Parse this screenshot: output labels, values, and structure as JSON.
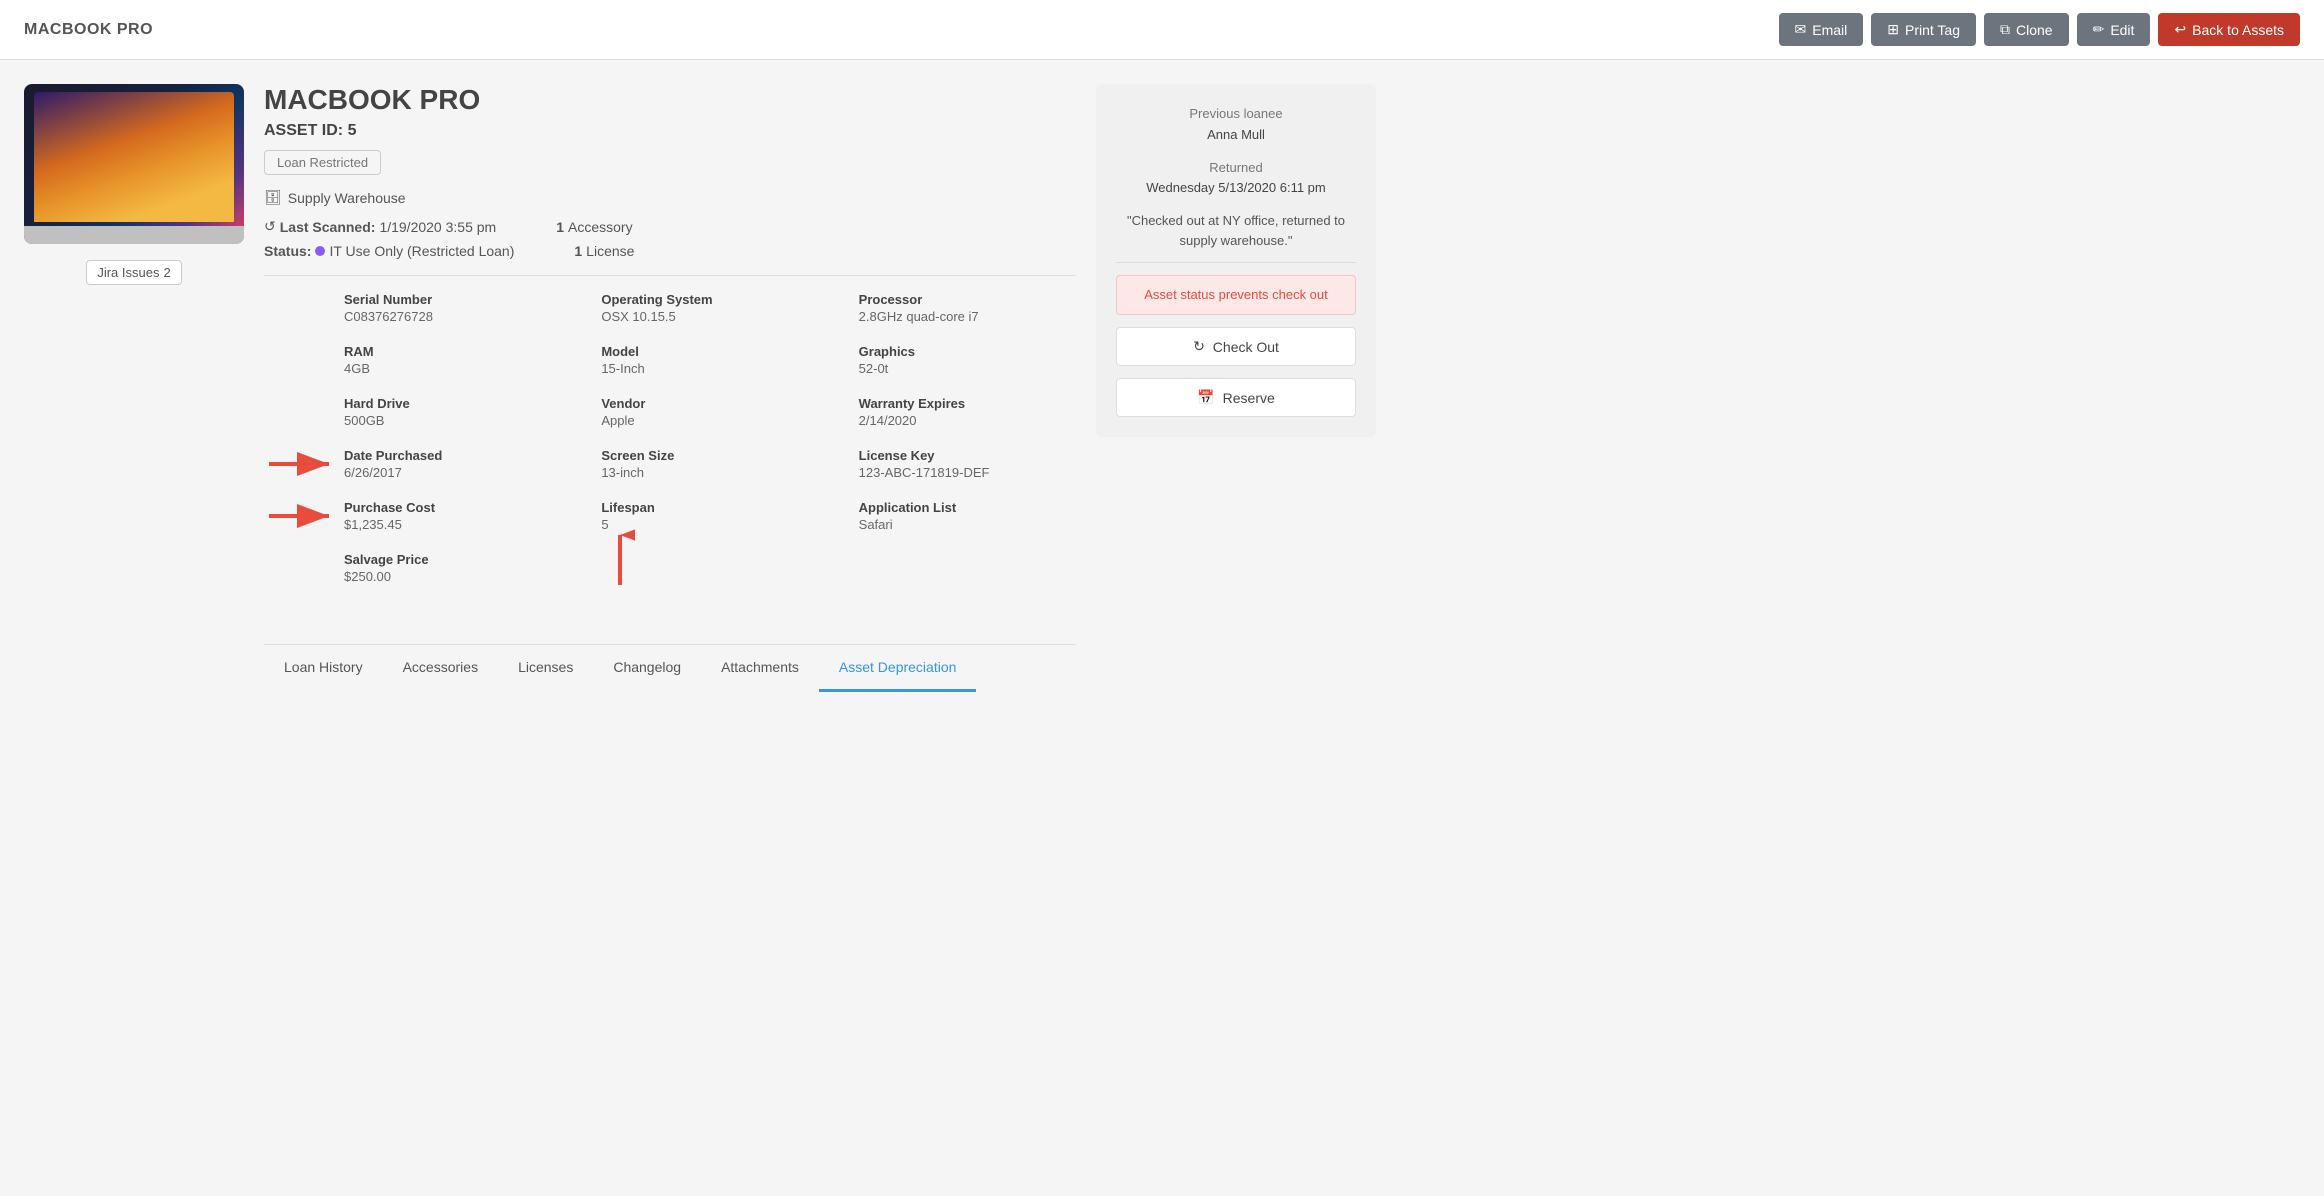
{
  "header": {
    "title": "MACBOOK PRO",
    "buttons": {
      "email": "Email",
      "print_tag": "Print Tag",
      "clone": "Clone",
      "edit": "Edit",
      "back": "Back to Assets"
    }
  },
  "asset": {
    "name": "MACBOOK PRO",
    "id_label": "ASSET ID:",
    "id_value": "5",
    "loan_status": "Loan Restricted",
    "location_icon": "🗄",
    "location": "Supply Warehouse",
    "last_scanned_label": "Last Scanned:",
    "last_scanned": "1/19/2020 3:55 pm",
    "accessory_count": "1",
    "accessory_label": "Accessory",
    "status_label": "Status:",
    "status_value": "IT Use Only (Restricted Loan)",
    "license_count": "1",
    "license_label": "License",
    "jira_label": "Jira Issues",
    "jira_count": "2"
  },
  "specs": [
    {
      "label": "Serial Number",
      "value": "C08376276728"
    },
    {
      "label": "Operating System",
      "value": "OSX 10.15.5"
    },
    {
      "label": "Processor",
      "value": "2.8GHz quad-core i7"
    },
    {
      "label": "RAM",
      "value": "4GB"
    },
    {
      "label": "Model",
      "value": "15-Inch"
    },
    {
      "label": "Graphics",
      "value": "52-0t"
    },
    {
      "label": "Hard Drive",
      "value": "500GB"
    },
    {
      "label": "Vendor",
      "value": "Apple"
    },
    {
      "label": "Warranty Expires",
      "value": "2/14/2020"
    },
    {
      "label": "Date Purchased",
      "value": "6/26/2017",
      "has_arrow": true
    },
    {
      "label": "Screen Size",
      "value": "13-inch"
    },
    {
      "label": "License Key",
      "value": "123-ABC-171819-DEF"
    },
    {
      "label": "Purchase Cost",
      "value": "$1,235.45",
      "has_arrow": true
    },
    {
      "label": "Lifespan",
      "value": "5",
      "has_arrow_up": true
    },
    {
      "label": "Application List",
      "value": "Safari"
    },
    {
      "label": "Salvage Price",
      "value": "$250.00"
    }
  ],
  "tabs": [
    {
      "label": "Loan History",
      "active": false
    },
    {
      "label": "Accessories",
      "active": false
    },
    {
      "label": "Licenses",
      "active": false
    },
    {
      "label": "Changelog",
      "active": false
    },
    {
      "label": "Attachments",
      "active": false
    },
    {
      "label": "Asset Depreciation",
      "active": true
    }
  ],
  "sidebar": {
    "previous_loanee_label": "Previous loanee",
    "previous_loanee": "Anna Mull",
    "returned_label": "Returned",
    "returned_date": "Wednesday 5/13/2020 6:11 pm",
    "quote": "\"Checked out at NY office, returned to supply warehouse.\"",
    "alert": "Asset status prevents check out",
    "checkout_label": "Check Out",
    "reserve_label": "Reserve"
  }
}
